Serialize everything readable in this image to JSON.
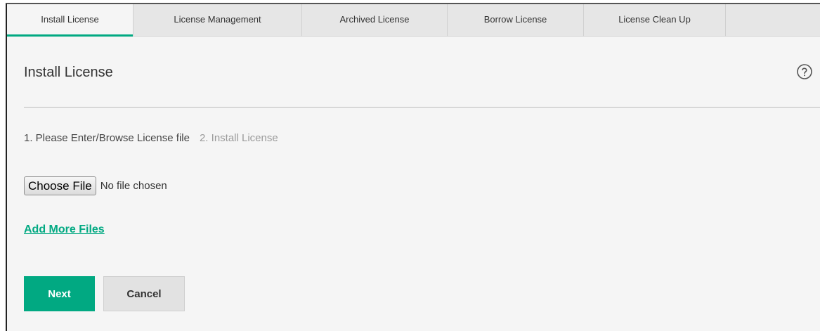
{
  "tabs": [
    {
      "label": "Install License",
      "active": true
    },
    {
      "label": "License Management",
      "active": false
    },
    {
      "label": "Archived License",
      "active": false
    },
    {
      "label": "Borrow License",
      "active": false
    },
    {
      "label": "License Clean Up",
      "active": false
    }
  ],
  "page": {
    "title": "Install License",
    "help_icon": "question-circle-icon"
  },
  "steps": {
    "step1": "1. Please Enter/Browse License file",
    "step2": "2. Install License"
  },
  "file_input": {
    "button_label": "Choose File",
    "status": "No file chosen"
  },
  "add_more_label": "Add More Files",
  "actions": {
    "next_label": "Next",
    "cancel_label": "Cancel"
  },
  "colors": {
    "accent": "#01a982",
    "tabbar_bg": "#e6e6e6",
    "page_bg": "#f5f5f5"
  }
}
